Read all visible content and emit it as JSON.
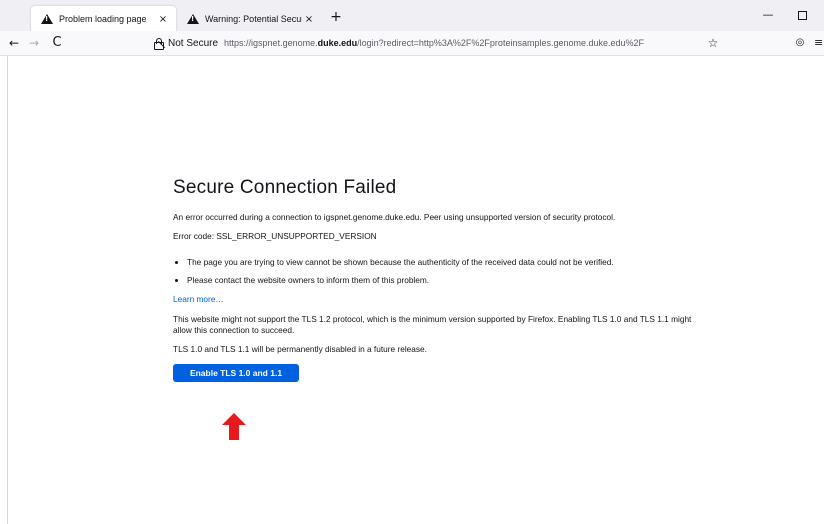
{
  "tabs": [
    {
      "title": "Problem loading page",
      "close": "×",
      "active": true
    },
    {
      "title": "Warning: Potential Security Risk",
      "close": "×",
      "active": false
    }
  ],
  "tabstrip": {
    "new_tab": "+"
  },
  "window_controls": {
    "minimize": "—",
    "close": "✕"
  },
  "navbar": {
    "back": "←",
    "forward": "→",
    "reload": "C",
    "not_secure": "Not Secure",
    "url_prefix": "https://igspnet.genome.",
    "url_host": "duke.edu",
    "url_suffix": "/login?redirect=http%3A%2F%2Fproteinsamples.genome.duke.edu%2F",
    "bookmark_star": "☆",
    "pocket": "◎",
    "menu": "≡"
  },
  "error_page": {
    "title": "Secure Connection Failed",
    "description": "An error occurred during a connection to igspnet.genome.duke.edu. Peer using unsupported version of security protocol.",
    "error_code": "Error code: SSL_ERROR_UNSUPPORTED_VERSION",
    "bullets": [
      "The page you are trying to view cannot be shown because the authenticity of the received data could not be verified.",
      "Please contact the website owners to inform them of this problem."
    ],
    "learn_more": "Learn more…",
    "tls_note": "This website might not support the TLS 1.2 protocol, which is the minimum version supported by Firefox. Enabling TLS 1.0 and TLS 1.1 might allow this connection to succeed.",
    "tls_disabled_note": "TLS 1.0 and TLS 1.1 will be permanently disabled in a future release.",
    "enable_button": "Enable TLS 1.0 and 1.1"
  },
  "colors": {
    "accent": "#0061e0",
    "annotation_arrow": "#e8191a"
  }
}
